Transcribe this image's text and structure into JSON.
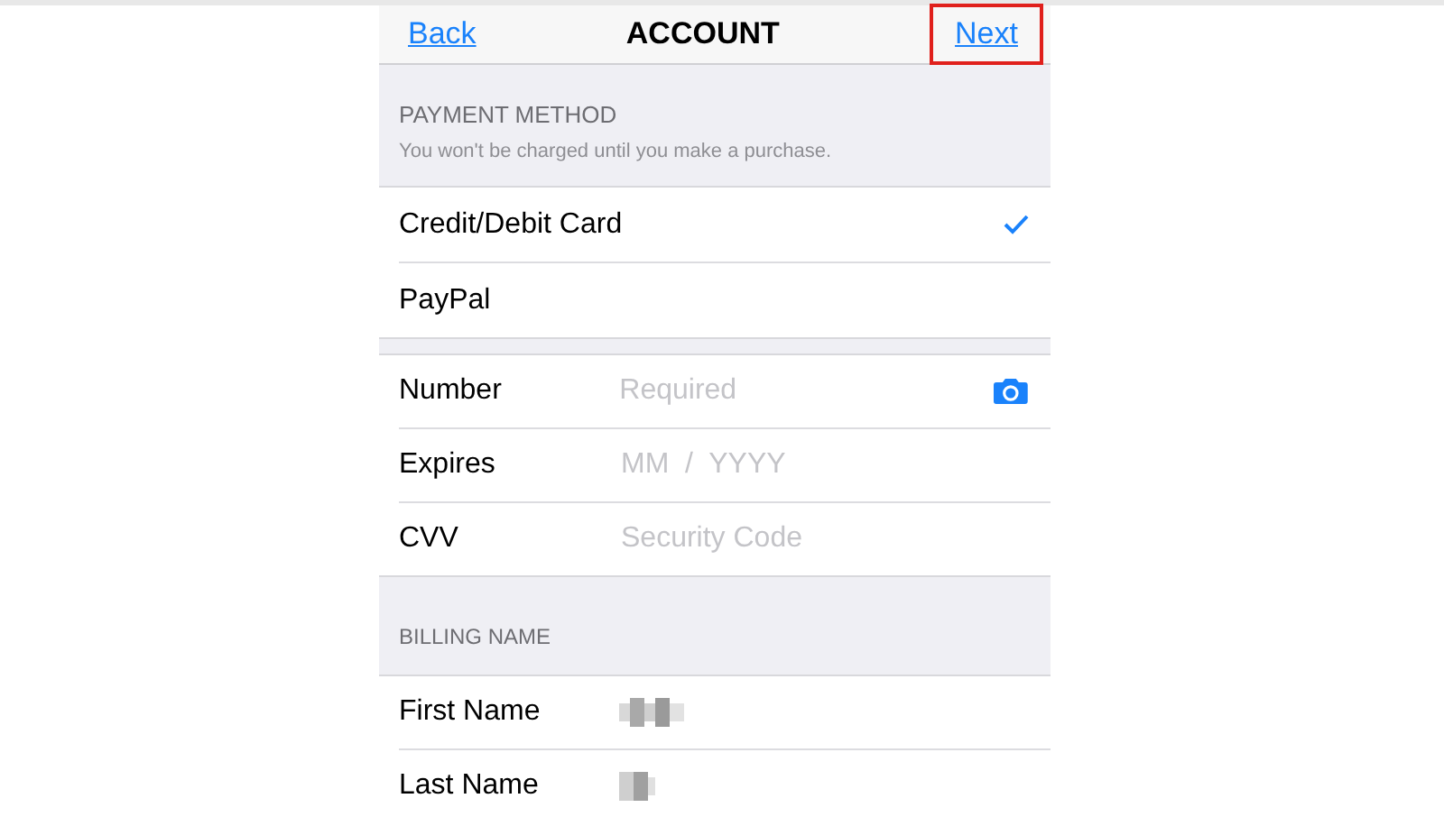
{
  "nav": {
    "back": "Back",
    "title": "ACCOUNT",
    "next": {
      "label": "Next",
      "highlighted": true
    }
  },
  "payment_method": {
    "header": "PAYMENT METHOD",
    "note": "You won't be charged until you make a purchase.",
    "options": [
      {
        "label": "Credit/Debit Card",
        "selected": true
      },
      {
        "label": "PayPal",
        "selected": false
      }
    ]
  },
  "card_fields": [
    {
      "label": "Number",
      "placeholder": "Required",
      "kind": "camera"
    },
    {
      "label": "Expires",
      "placeholder": "MM  /  YYYY",
      "kind": "plain"
    },
    {
      "label": "CVV",
      "placeholder": "Security Code",
      "kind": "plain"
    }
  ],
  "billing_name": {
    "header": "BILLING NAME",
    "fields": [
      {
        "label": "First Name",
        "value_hidden": true
      },
      {
        "label": "Last Name",
        "value_hidden": true
      }
    ]
  }
}
